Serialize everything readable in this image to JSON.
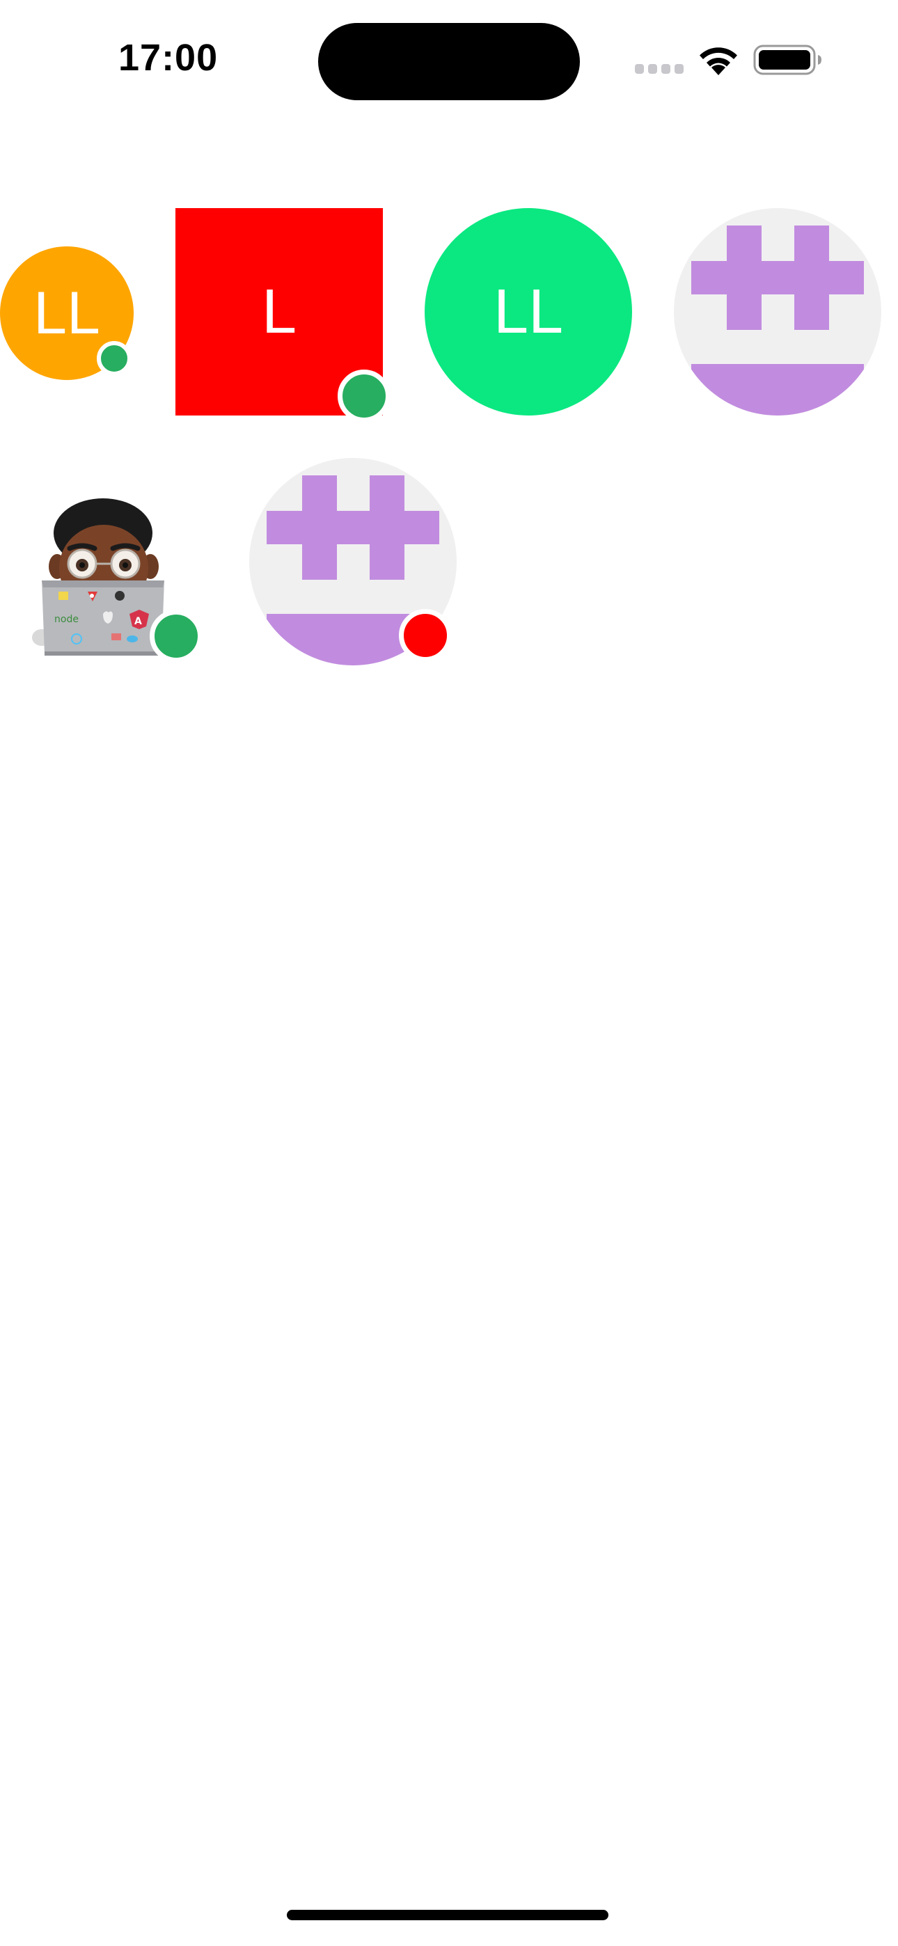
{
  "status_bar": {
    "time": "17:00",
    "icons": [
      "cellular-signal-icon",
      "wifi-icon",
      "battery-icon"
    ]
  },
  "colors": {
    "orange": "#FFA500",
    "red": "#FF0000",
    "green": "#0BE881",
    "online": "#27AE60",
    "busy": "#FF0000",
    "identicon_purple": "#C18CDF",
    "identicon_bg": "#F0F0F0"
  },
  "avatars": [
    {
      "type": "initials",
      "initials": "LL",
      "shape": "circle",
      "background": "#FFA500",
      "status": "online"
    },
    {
      "type": "initials",
      "initials": "L",
      "shape": "square",
      "background": "#FF0000",
      "status": "online"
    },
    {
      "type": "initials",
      "initials": "LL",
      "shape": "circle",
      "background": "#0BE881",
      "status": "none"
    },
    {
      "type": "identicon",
      "shape": "circle",
      "status": "none"
    },
    {
      "type": "memoji",
      "shape": "none",
      "status": "online"
    },
    {
      "type": "identicon",
      "shape": "circle",
      "status": "busy"
    }
  ]
}
